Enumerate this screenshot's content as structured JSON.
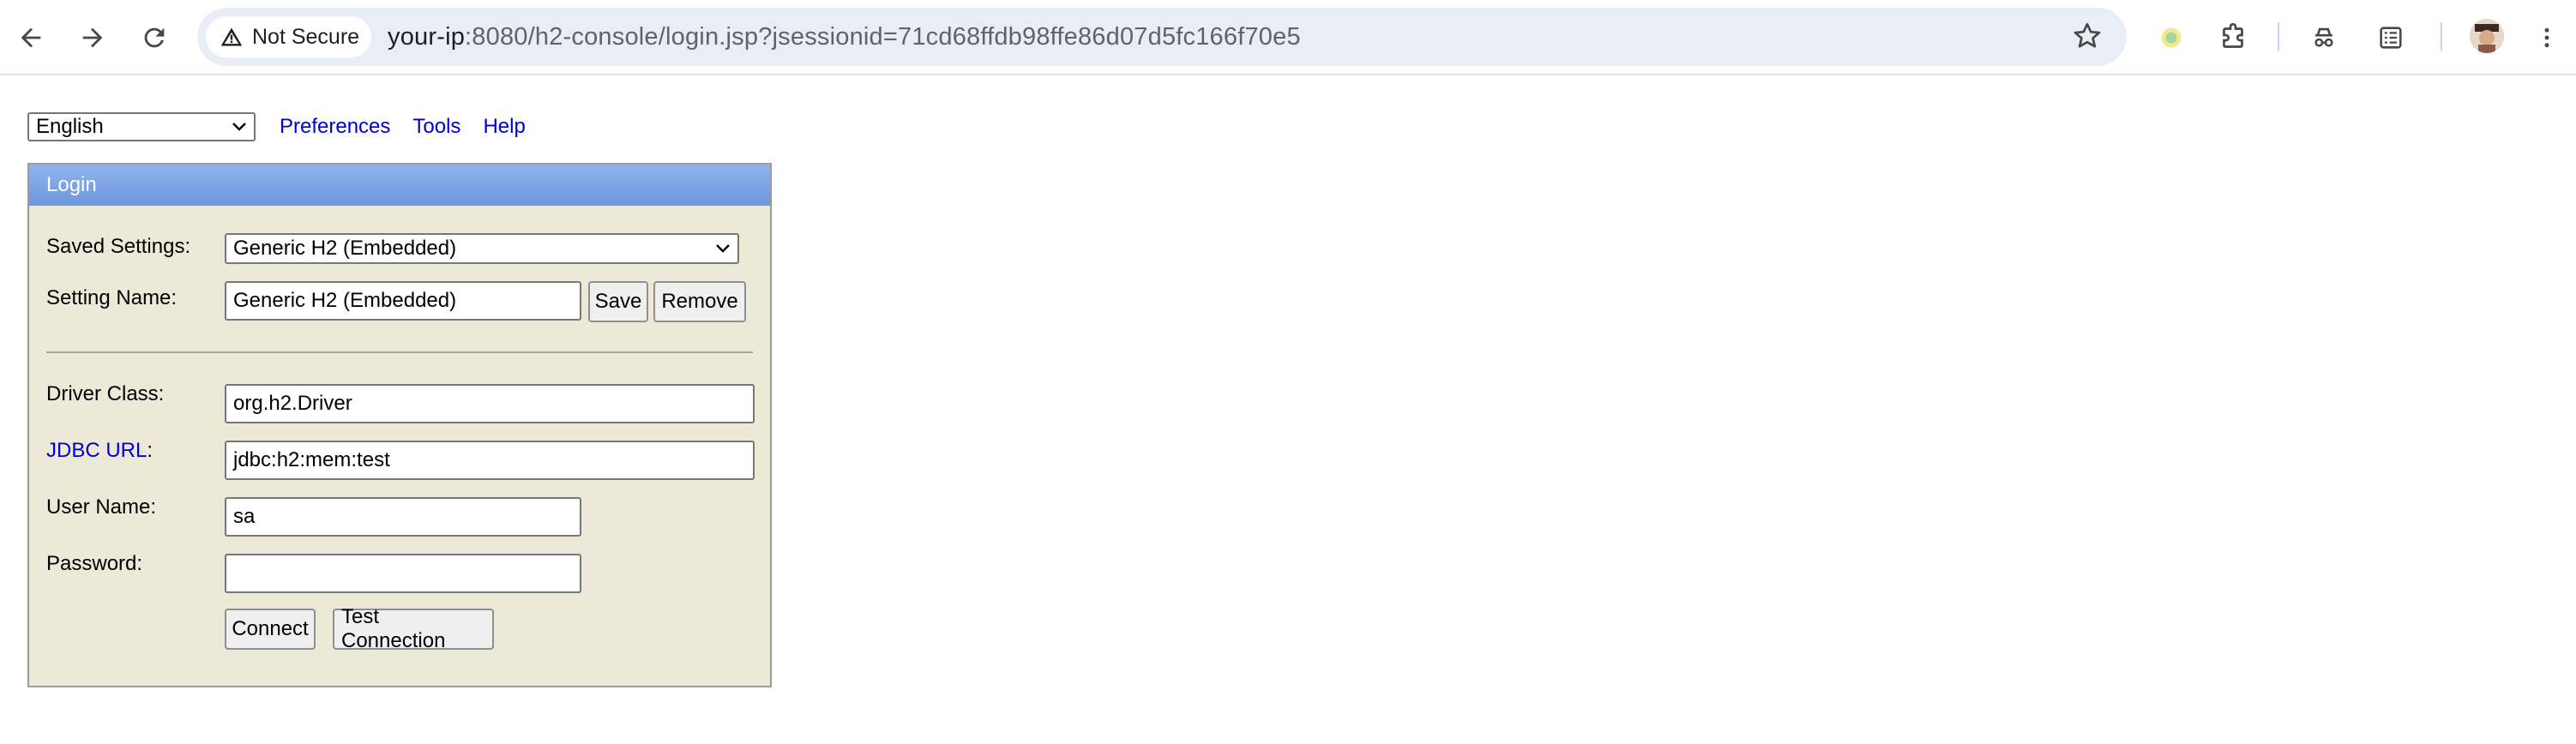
{
  "browser": {
    "security_label": "Not Secure",
    "url_host": "your-ip",
    "url_rest": ":8080/h2-console/login.jsp?jsessionid=71cd68ffdb98ffe86d07d5fc166f70e5",
    "icons": [
      "back-arrow-icon",
      "forward-arrow-icon",
      "reload-icon",
      "warning-icon",
      "star-icon",
      "extension-dot-icon",
      "puzzle-icon",
      "incognito-icon",
      "reading-list-icon",
      "avatar",
      "more-vert-icon"
    ]
  },
  "topbar": {
    "language_selected": "English",
    "links": [
      "Preferences",
      "Tools",
      "Help"
    ]
  },
  "login": {
    "title": "Login",
    "saved_settings_label": "Saved Settings:",
    "saved_settings_value": "Generic H2 (Embedded)",
    "setting_name_label": "Setting Name:",
    "setting_name_value": "Generic H2 (Embedded)",
    "save_label": "Save",
    "remove_label": "Remove",
    "driver_class_label": "Driver Class:",
    "driver_class_value": "org.h2.Driver",
    "jdbc_url_link": "JDBC URL",
    "jdbc_url_colon": ":",
    "jdbc_url_value": "jdbc:h2:mem:test",
    "user_name_label": "User Name:",
    "user_name_value": "sa",
    "password_label": "Password:",
    "password_value": "",
    "connect_label": "Connect",
    "test_connection_label": "Test Connection"
  }
}
